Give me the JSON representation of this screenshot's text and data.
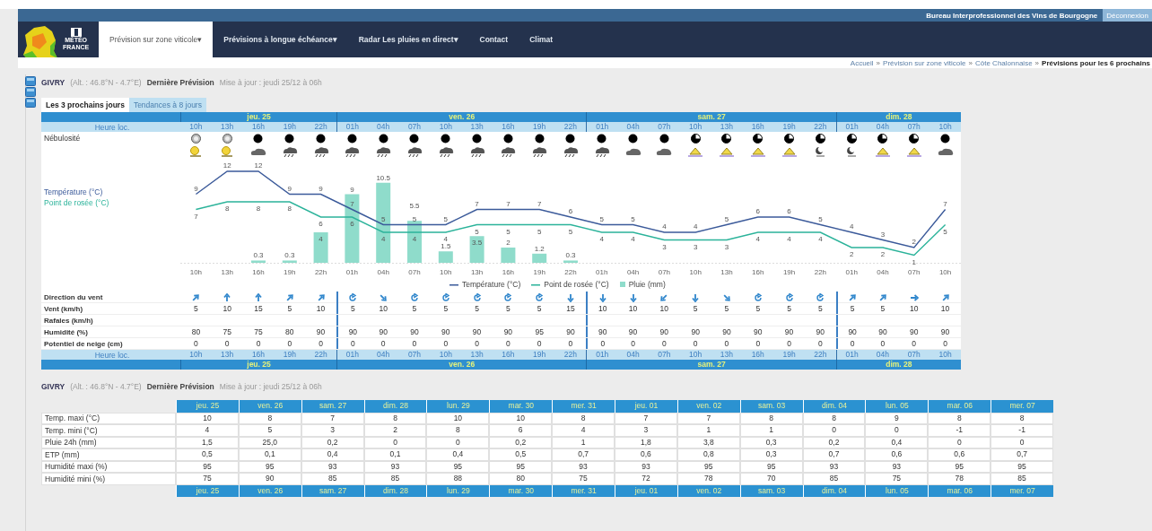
{
  "top_bar": {
    "organization": "Bureau Interprofessionnel des Vins de Bourgogne",
    "logout": "Déconnexion"
  },
  "logo": {
    "lines": [
      "MÉTÉO",
      "FRANCE"
    ]
  },
  "nav": [
    {
      "label": "Prévision sur zone viticole",
      "caret": "▾",
      "selected": true
    },
    {
      "label": "Prévisions à longue échéance",
      "caret": "▾",
      "selected": false
    },
    {
      "label": "Radar Les pluies en direct",
      "caret": "▾",
      "selected": false
    },
    {
      "label": "Contact",
      "selected": false
    },
    {
      "label": "Climat",
      "selected": false
    }
  ],
  "breadcrumb": {
    "separator": "»",
    "items": [
      "Accueil",
      "Prévision sur zone viticole",
      "Côte Chalonnaise",
      "Prévisions pour les 6 prochains"
    ]
  },
  "info": {
    "place": "GIVRY",
    "coords": "(Alt. : 46.8°N - 4.7°E)",
    "label": "Dernière Prévision",
    "updated": "Mise à jour : jeudi 25/12 à 06h"
  },
  "tabs": [
    {
      "label": "Les 3 prochains jours",
      "selected": true
    },
    {
      "label": "Tendances à 8 jours",
      "selected": false
    }
  ],
  "forecast": {
    "header_top": {
      "corner": "Heure loc.",
      "days": [
        {
          "label": "jeu. 25",
          "hours": [
            "10h",
            "13h",
            "16h",
            "19h",
            "22h"
          ]
        },
        {
          "label": "ven. 26",
          "hours": [
            "01h",
            "04h",
            "07h",
            "10h",
            "13h",
            "16h",
            "19h",
            "22h"
          ]
        },
        {
          "label": "sam. 27",
          "hours": [
            "01h",
            "04h",
            "07h",
            "10h",
            "13h",
            "16h",
            "19h",
            "22h"
          ]
        },
        {
          "label": "dim. 28",
          "hours": [
            "01h",
            "04h",
            "07h",
            "10h"
          ]
        }
      ]
    },
    "row_labels": {
      "cover": "Nébulosité",
      "wind_dir": "Direction du vent",
      "wind": "Vent (km/h)",
      "gusts": "Rafales (km/h)",
      "humidity": "Humidité (%)",
      "snow": "Potentiel de neige (cm)"
    },
    "columns": [
      {
        "cover": {
          "kind": "light"
        },
        "weather": {
          "kind": "sun"
        },
        "wind_dir": {
          "kind": "NE"
        },
        "wind": "5",
        "humidity": "80",
        "snow": "0"
      },
      {
        "cover": {
          "kind": "light"
        },
        "weather": {
          "kind": "sun"
        },
        "wind_dir": {
          "kind": "N"
        },
        "wind": "10",
        "humidity": "75",
        "snow": "0"
      },
      {
        "cover": {
          "kind": "full"
        },
        "weather": {
          "kind": "cloud"
        },
        "wind_dir": {
          "kind": "N"
        },
        "wind": "15",
        "humidity": "75",
        "snow": "0"
      },
      {
        "cover": {
          "kind": "full"
        },
        "weather": {
          "kind": "rain"
        },
        "wind_dir": {
          "kind": "NE"
        },
        "wind": "5",
        "humidity": "80",
        "snow": "0"
      },
      {
        "cover": {
          "kind": "full"
        },
        "weather": {
          "kind": "rain"
        },
        "wind_dir": {
          "kind": "NE"
        },
        "wind": "10",
        "humidity": "90",
        "snow": "0"
      },
      {
        "cover": {
          "kind": "full"
        },
        "weather": {
          "kind": "rain"
        },
        "wind_dir": {
          "kind": "variable"
        },
        "wind": "5",
        "humidity": "90",
        "snow": "0"
      },
      {
        "cover": {
          "kind": "full"
        },
        "weather": {
          "kind": "rain"
        },
        "wind_dir": {
          "kind": "SE"
        },
        "wind": "10",
        "humidity": "90",
        "snow": "0"
      },
      {
        "cover": {
          "kind": "full"
        },
        "weather": {
          "kind": "rain"
        },
        "wind_dir": {
          "kind": "variable"
        },
        "wind": "5",
        "humidity": "90",
        "snow": "0"
      },
      {
        "cover": {
          "kind": "full"
        },
        "weather": {
          "kind": "rain"
        },
        "wind_dir": {
          "kind": "variable"
        },
        "wind": "5",
        "humidity": "90",
        "snow": "0"
      },
      {
        "cover": {
          "kind": "full"
        },
        "weather": {
          "kind": "rain"
        },
        "wind_dir": {
          "kind": "variable"
        },
        "wind": "5",
        "humidity": "90",
        "snow": "0"
      },
      {
        "cover": {
          "kind": "full"
        },
        "weather": {
          "kind": "rain"
        },
        "wind_dir": {
          "kind": "variable"
        },
        "wind": "5",
        "humidity": "90",
        "snow": "0"
      },
      {
        "cover": {
          "kind": "full"
        },
        "weather": {
          "kind": "rain"
        },
        "wind_dir": {
          "kind": "variable"
        },
        "wind": "5",
        "humidity": "95",
        "snow": "0"
      },
      {
        "cover": {
          "kind": "full"
        },
        "weather": {
          "kind": "rain"
        },
        "wind_dir": {
          "kind": "S"
        },
        "wind": "15",
        "humidity": "90",
        "snow": "0"
      },
      {
        "cover": {
          "kind": "full"
        },
        "weather": {
          "kind": "rain"
        },
        "wind_dir": {
          "kind": "S"
        },
        "wind": "10",
        "humidity": "90",
        "snow": "0"
      },
      {
        "cover": {
          "kind": "full"
        },
        "weather": {
          "kind": "cloud"
        },
        "wind_dir": {
          "kind": "S"
        },
        "wind": "10",
        "humidity": "90",
        "snow": "0"
      },
      {
        "cover": {
          "kind": "full"
        },
        "weather": {
          "kind": "cloud"
        },
        "wind_dir": {
          "kind": "SW"
        },
        "wind": "10",
        "humidity": "90",
        "snow": "0"
      },
      {
        "cover": {
          "kind": "half"
        },
        "weather": {
          "kind": "haze"
        },
        "wind_dir": {
          "kind": "S"
        },
        "wind": "5",
        "humidity": "90",
        "snow": "0"
      },
      {
        "cover": {
          "kind": "half"
        },
        "weather": {
          "kind": "haze"
        },
        "wind_dir": {
          "kind": "SE"
        },
        "wind": "5",
        "humidity": "90",
        "snow": "0"
      },
      {
        "cover": {
          "kind": "half"
        },
        "weather": {
          "kind": "haze"
        },
        "wind_dir": {
          "kind": "variable"
        },
        "wind": "5",
        "humidity": "90",
        "snow": "0"
      },
      {
        "cover": {
          "kind": "half"
        },
        "weather": {
          "kind": "haze"
        },
        "wind_dir": {
          "kind": "variable"
        },
        "wind": "5",
        "humidity": "90",
        "snow": "0"
      },
      {
        "cover": {
          "kind": "half"
        },
        "weather": {
          "kind": "night"
        },
        "wind_dir": {
          "kind": "variable"
        },
        "wind": "5",
        "humidity": "90",
        "snow": "0"
      },
      {
        "cover": {
          "kind": "half"
        },
        "weather": {
          "kind": "night"
        },
        "wind_dir": {
          "kind": "NE"
        },
        "wind": "5",
        "humidity": "90",
        "snow": "0"
      },
      {
        "cover": {
          "kind": "half"
        },
        "weather": {
          "kind": "haze"
        },
        "wind_dir": {
          "kind": "NE"
        },
        "wind": "5",
        "humidity": "90",
        "snow": "0"
      },
      {
        "cover": {
          "kind": "half"
        },
        "weather": {
          "kind": "haze"
        },
        "wind_dir": {
          "kind": "E"
        },
        "wind": "10",
        "humidity": "90",
        "snow": "0"
      },
      {
        "cover": {
          "kind": "full"
        },
        "weather": {
          "kind": "cloud"
        },
        "wind_dir": {
          "kind": "NE"
        },
        "wind": "10",
        "humidity": "90",
        "snow": "0"
      }
    ],
    "axis_labels": [
      "Température (°C)",
      "Point de rosée (°C)"
    ],
    "chart_data": {
      "type": "line",
      "categories": [
        "10h",
        "13h",
        "16h",
        "19h",
        "22h",
        "01h",
        "04h",
        "07h",
        "10h",
        "13h",
        "16h",
        "19h",
        "22h",
        "01h",
        "04h",
        "07h",
        "10h",
        "13h",
        "16h",
        "19h",
        "22h",
        "01h",
        "04h",
        "07h",
        "10h"
      ],
      "series": [
        {
          "name": "Température (°C)",
          "color": "#3b5a9a",
          "values": [
            9,
            12,
            12,
            9,
            9,
            7,
            5,
            5,
            5,
            7,
            7,
            7,
            6,
            5,
            5,
            4,
            4,
            5,
            6,
            6,
            5,
            4,
            3,
            2,
            7
          ],
          "value_labels": [
            "9",
            "12",
            "12",
            "9",
            "9",
            "7",
            "5",
            "5",
            "5",
            "7",
            "7",
            "7",
            "6",
            "5",
            "5",
            "4",
            "4",
            "5",
            "6",
            "6",
            "5",
            "4",
            "3",
            "2",
            "7"
          ]
        },
        {
          "name": "Point de rosée (°C)",
          "color": "#2bb39a",
          "values": [
            7,
            8,
            8,
            8,
            6,
            6,
            4,
            4,
            4,
            5,
            5,
            5,
            5,
            4,
            4,
            3,
            3,
            3,
            4,
            4,
            4,
            2,
            2,
            1,
            5
          ],
          "value_labels": [
            "7",
            "8",
            "8",
            "8",
            "6",
            "6",
            "4",
            "4",
            "4",
            "5",
            "5",
            "5",
            "5",
            "4",
            "4",
            "3",
            "3",
            "3",
            "4",
            "4",
            "4",
            "2",
            "2",
            "1",
            "5"
          ]
        },
        {
          "name": "Pluie (mm)",
          "type": "bar",
          "color": "#8fdccb",
          "values": [
            0,
            0,
            0.3,
            0.3,
            4,
            9,
            10.5,
            5.5,
            1.5,
            3.5,
            2,
            1.2,
            0.3,
            0,
            0,
            0,
            0,
            0,
            0,
            0,
            0,
            0,
            0,
            0,
            0
          ],
          "value_labels": [
            null,
            null,
            "0.3",
            "0.3",
            "4",
            "9",
            "10.5",
            "5.5",
            "1.5",
            "3.5",
            "2",
            "1.2",
            "0.3",
            null,
            null,
            null,
            null,
            null,
            null,
            null,
            null,
            null,
            null,
            null,
            null
          ]
        }
      ]
    },
    "header_bottom": {
      "corner": "Heure loc.",
      "days": [
        {
          "label": "jeu. 25",
          "hours": [
            "10h",
            "13h",
            "16h",
            "19h",
            "22h"
          ]
        },
        {
          "label": "ven. 26",
          "hours": [
            "01h",
            "04h",
            "07h",
            "10h",
            "13h",
            "16h",
            "19h",
            "22h"
          ]
        },
        {
          "label": "sam. 27",
          "hours": [
            "01h",
            "04h",
            "07h",
            "10h",
            "13h",
            "16h",
            "19h",
            "22h"
          ]
        },
        {
          "label": "dim. 28",
          "hours": [
            "01h",
            "04h",
            "07h",
            "10h"
          ]
        }
      ]
    }
  },
  "info2": {
    "place": "GIVRY",
    "coords": "(Alt. : 46.8°N - 4.7°E)",
    "label": "Dernière Prévision",
    "updated": "Mise à jour : jeudi 25/12 à 06h"
  },
  "trend": {
    "days": [
      "jeu. 25",
      "ven. 26",
      "sam. 27",
      "dim. 28",
      "lun. 29",
      "mar. 30",
      "mer. 31",
      "jeu. 01",
      "ven. 02",
      "sam. 03",
      "dim. 04",
      "lun. 05",
      "mar. 06",
      "mer. 07"
    ],
    "rows": [
      {
        "label": "Temp. maxi (°C)",
        "values": [
          "10",
          "8",
          "7",
          "8",
          "10",
          "10",
          "8",
          "7",
          "7",
          "8",
          "8",
          "9",
          "8",
          "8"
        ]
      },
      {
        "label": "Temp. mini (°C)",
        "values": [
          "4",
          "5",
          "3",
          "2",
          "8",
          "6",
          "4",
          "3",
          "1",
          "1",
          "0",
          "0",
          "-1",
          "-1"
        ]
      },
      {
        "label": "Pluie 24h (mm)",
        "values": [
          "1,5",
          "25,0",
          "0,2",
          "0",
          "0",
          "0,2",
          "1",
          "1,8",
          "3,8",
          "0,3",
          "0,2",
          "0,4",
          "0",
          "0"
        ]
      },
      {
        "label": "ETP (mm)",
        "values": [
          "0,5",
          "0,1",
          "0,4",
          "0,1",
          "0,4",
          "0,5",
          "0,7",
          "0,6",
          "0,8",
          "0,3",
          "0,7",
          "0,6",
          "0,6",
          "0,7"
        ]
      },
      {
        "label": "Humidité maxi (%)",
        "values": [
          "95",
          "95",
          "93",
          "93",
          "95",
          "95",
          "93",
          "93",
          "95",
          "95",
          "93",
          "93",
          "95",
          "95"
        ]
      },
      {
        "label": "Humidité mini (%)",
        "values": [
          "75",
          "90",
          "85",
          "85",
          "88",
          "80",
          "75",
          "72",
          "78",
          "70",
          "85",
          "75",
          "78",
          "85"
        ]
      }
    ],
    "footer_days": [
      "jeu. 25",
      "ven. 26",
      "sam. 27",
      "dim. 28",
      "lun. 29",
      "mar. 30",
      "mer. 31",
      "jeu. 01",
      "ven. 02",
      "sam. 03",
      "dim. 04",
      "lun. 05",
      "mar. 06",
      "mer. 07"
    ]
  }
}
